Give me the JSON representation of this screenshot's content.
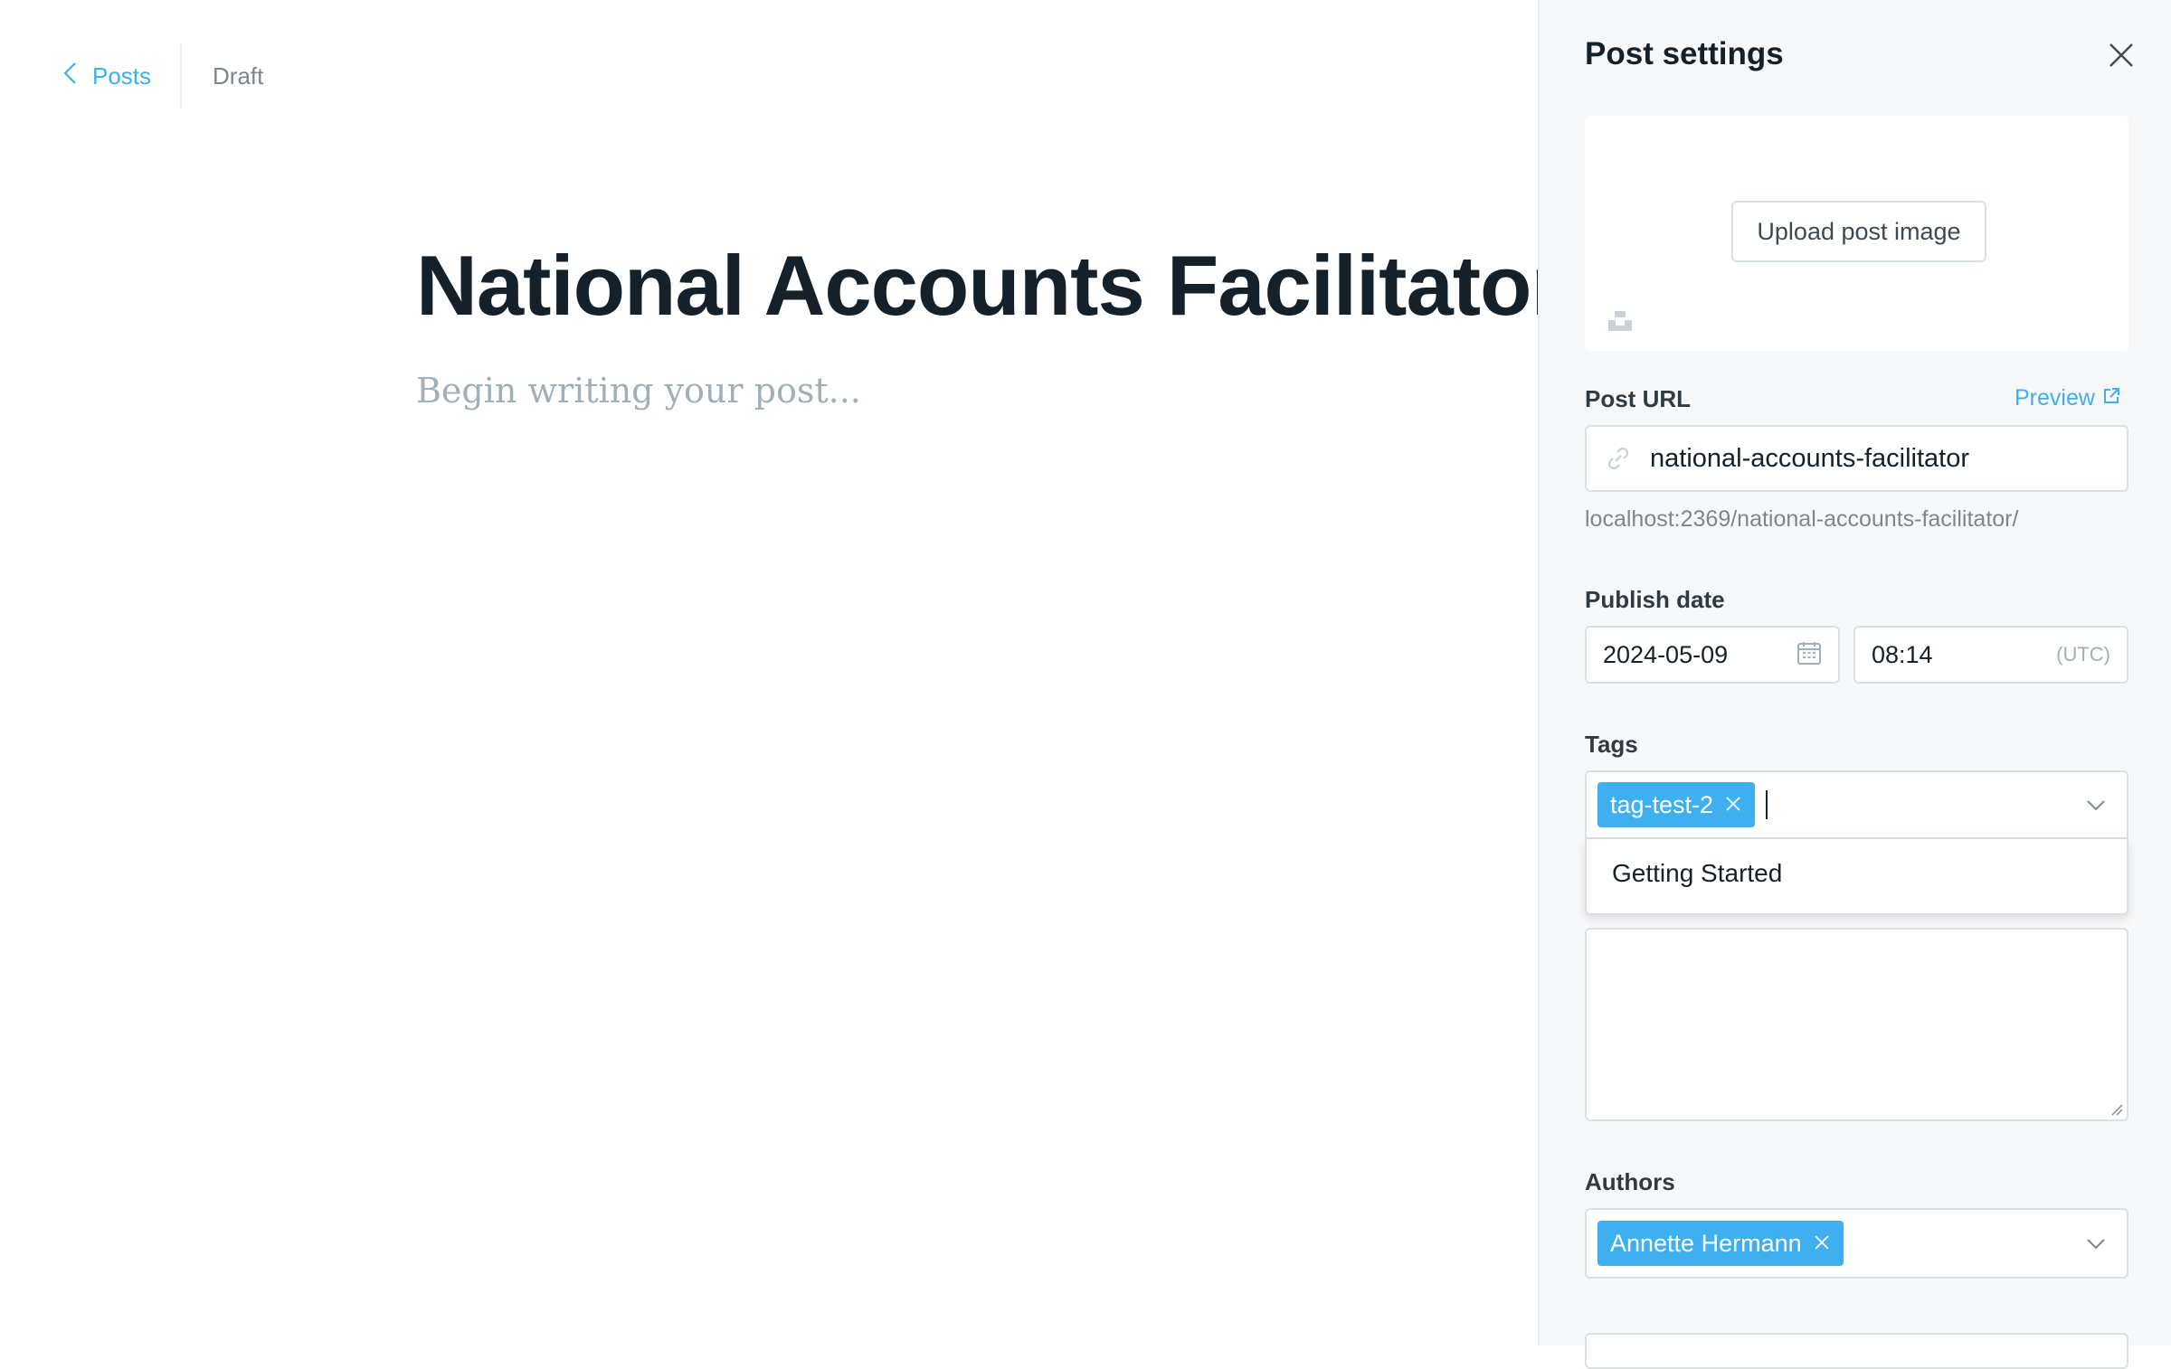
{
  "breadcrumb": {
    "back_label": "Posts",
    "status": "Draft"
  },
  "editor": {
    "title": "National Accounts Facilitator",
    "body_placeholder": "Begin writing your post..."
  },
  "settings": {
    "title": "Post settings",
    "upload_label": "Upload post image",
    "post_url": {
      "label": "Post URL",
      "preview_label": "Preview",
      "value": "national-accounts-facilitator",
      "hint": "localhost:2369/national-accounts-facilitator/"
    },
    "publish_date": {
      "label": "Publish date",
      "date": "2024-05-09",
      "time": "08:14",
      "timezone": "(UTC)"
    },
    "tags": {
      "label": "Tags",
      "selected": [
        "tag-test-2"
      ],
      "options": [
        "Getting Started"
      ]
    },
    "authors": {
      "label": "Authors",
      "selected": [
        "Annette Hermann"
      ]
    }
  },
  "colors": {
    "accent": "#3eb0ef",
    "panel_bg": "#f7f8f9",
    "title_text": "#15212a",
    "placeholder_text": "#9fb0ba",
    "border": "#dae1e5"
  },
  "icons": [
    "chevron-left-icon",
    "close-icon",
    "unsplash-icon",
    "external-link-icon",
    "link-icon",
    "calendar-icon",
    "chevron-down-icon"
  ]
}
